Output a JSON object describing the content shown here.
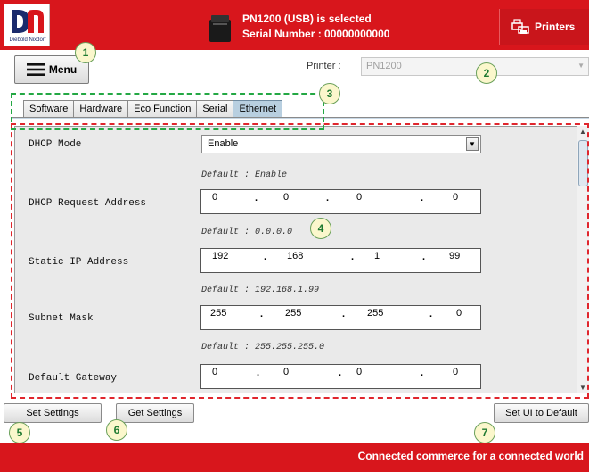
{
  "header": {
    "logo_text": "Diebold Nixdorf",
    "selected_line": "PN1200 (USB) is selected",
    "serial_line": "Serial Number : 00000000000",
    "printers_label": "Printers"
  },
  "toolbar": {
    "menu_label": "Menu",
    "printer_label": "Printer :",
    "printer_value": "PN1200"
  },
  "tabs": [
    {
      "label": "Software",
      "active": false
    },
    {
      "label": "Hardware",
      "active": false
    },
    {
      "label": "Eco Function",
      "active": false
    },
    {
      "label": "Serial",
      "active": false
    },
    {
      "label": "Ethernet",
      "active": true
    }
  ],
  "fields": {
    "dhcp_mode": {
      "label": "DHCP Mode",
      "value": "Enable",
      "default": "Default : Enable"
    },
    "dhcp_request": {
      "label": "DHCP Request Address",
      "octets": [
        "0",
        "0",
        "0",
        "0"
      ],
      "default": "Default : 0.0.0.0"
    },
    "static_ip": {
      "label": "Static IP Address",
      "octets": [
        "192",
        "168",
        "1",
        "99"
      ],
      "default": "Default : 192.168.1.99"
    },
    "subnet": {
      "label": "Subnet Mask",
      "octets": [
        "255",
        "255",
        "255",
        "0"
      ],
      "default": "Default : 255.255.255.0"
    },
    "gateway": {
      "label": "Default Gateway",
      "octets": [
        "0",
        "0",
        "0",
        "0"
      ]
    }
  },
  "buttons": {
    "set_settings": "Set Settings",
    "get_settings": "Get Settings",
    "set_ui_default": "Set UI to Default"
  },
  "footer": {
    "tagline": "Connected commerce for a connected world"
  },
  "annotations": [
    "1",
    "2",
    "3",
    "4",
    "5",
    "6",
    "7"
  ],
  "colors": {
    "brand_red": "#d8161c",
    "active_tab": "#b8cfe0",
    "annotation_green": "#24a844",
    "annotation_red": "#e0262d",
    "badge_fill": "#fbf7cc"
  }
}
